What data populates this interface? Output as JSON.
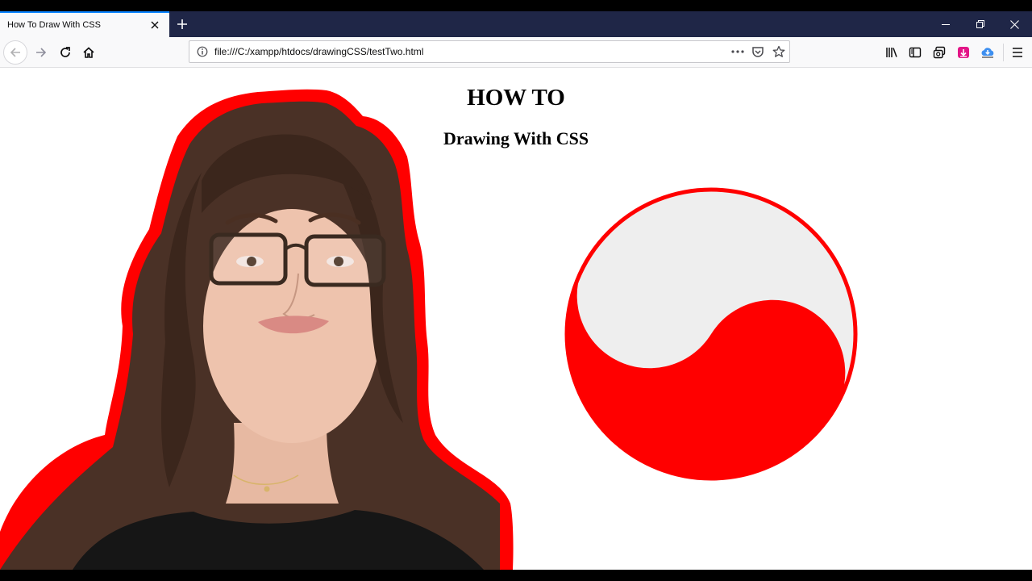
{
  "browser": {
    "tab_title": "How To Draw With CSS",
    "url": "file:///C:/xampp/htdocs/drawingCSS/testTwo.html",
    "icons": {
      "tab_close": "close-icon",
      "new_tab": "plus-icon",
      "minimize": "minimize-icon",
      "restore": "restore-icon",
      "close_window": "close-icon",
      "back": "arrow-left-icon",
      "forward": "arrow-right-icon",
      "reload": "reload-icon",
      "home": "home-icon",
      "site_info": "info-icon",
      "page_actions": "more-horizontal-icon",
      "pocket": "pocket-icon",
      "bookmark": "star-icon",
      "library": "library-icon",
      "sidebar": "sidebar-icon",
      "synced_tabs": "synced-tabs-icon",
      "extension": "extension-icon",
      "download": "download-cloud-icon",
      "menu": "hamburger-menu-icon"
    }
  },
  "page": {
    "heading": "HOW TO",
    "subheading": "Drawing With CSS",
    "yin_yang_colors": {
      "dark": "#ff0000",
      "light": "#eeeeee"
    },
    "portrait_outline_color": "#ff0000"
  }
}
